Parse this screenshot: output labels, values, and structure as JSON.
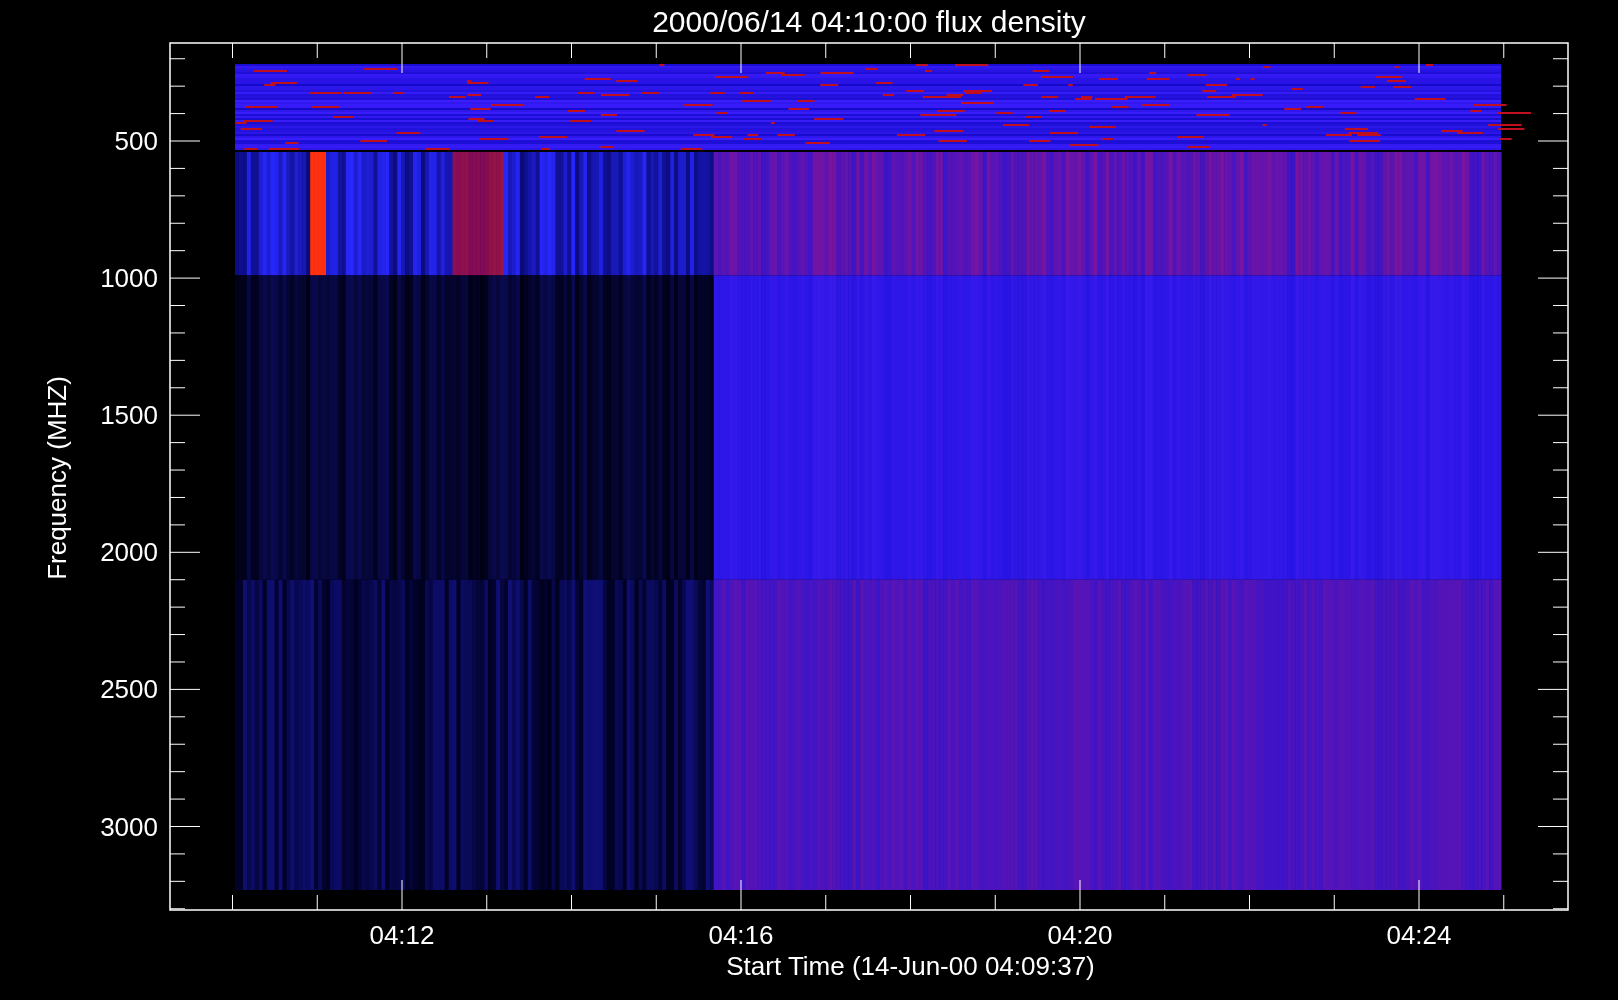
{
  "plot": {
    "title": "2000/06/14 04:10:00 flux density",
    "xlabel": "Start Time (14-Jun-00 04:09:37)",
    "ylabel": "Frequency (MHZ)",
    "xticks": [
      "04:12",
      "04:16",
      "04:20",
      "04:24"
    ],
    "yticks": [
      "500",
      "1000",
      "1500",
      "2000",
      "2500",
      "3000"
    ]
  }
}
